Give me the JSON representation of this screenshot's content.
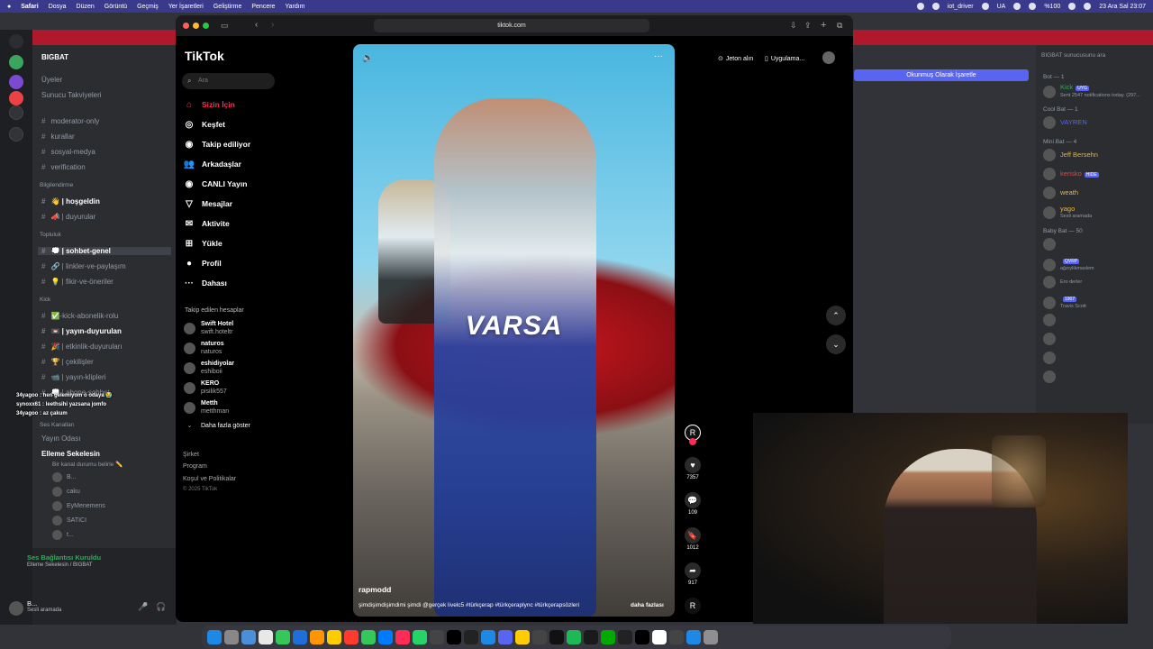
{
  "menubar": {
    "items": [
      "Safari",
      "Dosya",
      "Düzen",
      "Görüntü",
      "Geçmiş",
      "Yer İşaretleri",
      "Geliştirme",
      "Pencere",
      "Yardım"
    ],
    "status": [
      "iot_driver",
      "UA",
      "%100",
      "23 Ara Sal 23:07"
    ]
  },
  "discord": {
    "server_name": "BIGBAT",
    "top_channels": [
      "Üyeler",
      "Sunucu Takviyeleri"
    ],
    "channels": [
      {
        "name": "moderator-only"
      },
      {
        "name": "kurallar"
      },
      {
        "name": "sosyal-medya"
      },
      {
        "name": "verification"
      },
      {
        "cat": "Bilgilendirme"
      },
      {
        "name": "👋 | hoşgeldin",
        "bold": true
      },
      {
        "name": "📣 | duyurular"
      },
      {
        "cat": "Topluluk"
      },
      {
        "name": "💭 | sohbet-genel",
        "active": true
      },
      {
        "name": "🔗 | linkler-ve-paylaşım"
      },
      {
        "name": "💡 | fikir-ve-öneriler"
      },
      {
        "cat": "Kick"
      },
      {
        "name": "✅-kick-abonelik-rolu"
      },
      {
        "name": "📼 | yayın-duyurulan",
        "bold": true
      },
      {
        "name": "🎉 | etkinlik-duyuruları"
      },
      {
        "name": "🏆 | çekilişler"
      },
      {
        "name": "📹 | yayın-klipleri"
      },
      {
        "name": "💭 | abone-sohbet"
      }
    ],
    "voice_category": "Ses Kanalları",
    "voice_channels": [
      "Yayın Odası",
      "Elleme Sekelesin"
    ],
    "voice_status": "Bir kanal durumu belirle ✏️",
    "voice_users": [
      "B...",
      "caku",
      "EyMenemens",
      "SATICI",
      "t..."
    ],
    "overlay_chat": [
      "34yagoo : hen gelemiyom o odaya 😭",
      "synoxx61 : leethsihi yazsana jomfo",
      "34yagoo : az çakum"
    ],
    "connection": {
      "title": "Ses Bağlantısı Kuruldu",
      "sub": "Elleme Sekelesin / BIGBAT"
    },
    "user": {
      "name": "B...",
      "status": "Sesli aramada"
    },
    "unread_button": "Okunmuş Olarak İşaretle",
    "search_placeholder": "BIGBAT sunucusunu ara",
    "member_groups": [
      {
        "title": "Bot — 1",
        "members": [
          {
            "name": "Kick",
            "badge": "UYG",
            "sub": "Sent 2547 notifications today. (297...",
            "color": "#3ba55d"
          }
        ]
      },
      {
        "title": "Cool Bat — 1",
        "members": [
          {
            "name": "VAYREN",
            "color": "#5865f2"
          }
        ]
      },
      {
        "title": "Mini Bat — 4",
        "members": [
          {
            "name": "Jeff Bersehn",
            "color": "#f0b232"
          },
          {
            "name": "kerisko",
            "badge": "HIDE",
            "color": "#ed4245"
          },
          {
            "name": "weath",
            "color": "#f0b232"
          },
          {
            "name": "yago",
            "sub": "Sesli aramada",
            "color": "#f0b232"
          }
        ]
      },
      {
        "title": "Baby Bat — 50",
        "members": [
          {
            "name": "",
            "color": "#eb459e"
          },
          {
            "name": "",
            "badge": "QVRP",
            "sub": "ağzıylikmaslem",
            "color": "#eb459e"
          },
          {
            "name": "",
            "sub": "Ero derler",
            "color": "#eb459e"
          },
          {
            "name": "",
            "badge": "1907",
            "sub": "Travis Scott",
            "color": "#eb459e"
          },
          {
            "name": "",
            "color": "#eb459e"
          },
          {
            "name": "",
            "color": "#eb459e"
          },
          {
            "name": "",
            "color": "#eb459e"
          },
          {
            "name": "",
            "color": "#eb459e"
          }
        ]
      }
    ]
  },
  "safari": {
    "url": "tiktok.com"
  },
  "tiktok": {
    "logo": "TikTok",
    "search_placeholder": "Ara",
    "nav": [
      {
        "label": "Sizin İçin",
        "icon": "⌂",
        "active": true
      },
      {
        "label": "Keşfet",
        "icon": "◎"
      },
      {
        "label": "Takip ediliyor",
        "icon": "◉"
      },
      {
        "label": "Arkadaşlar",
        "icon": "👥"
      },
      {
        "label": "CANLI Yayın",
        "icon": "◉"
      },
      {
        "label": "Mesajlar",
        "icon": "▽"
      },
      {
        "label": "Aktivite",
        "icon": "✉"
      },
      {
        "label": "Yükle",
        "icon": "⊞"
      },
      {
        "label": "Profil",
        "icon": "●"
      },
      {
        "label": "Dahası",
        "icon": "···"
      }
    ],
    "following_title": "Takip edilen hesaplar",
    "following": [
      {
        "name": "Swift Hotel",
        "handle": "swift.hoteltr"
      },
      {
        "name": "naturos",
        "handle": "naturos"
      },
      {
        "name": "eshidiyolar",
        "handle": "eshiboii"
      },
      {
        "name": "KERO",
        "handle": "pisilik557"
      },
      {
        "name": "Metth",
        "handle": "metthman"
      }
    ],
    "show_more": "Daha fazla göster",
    "footer": [
      "Şirket",
      "Program",
      "Koşul ve Politikalar",
      "© 2025 TikTok"
    ],
    "top_buttons": [
      "Jeton alın",
      "Uygulama..."
    ],
    "video": {
      "overlay_text": "VARSA",
      "author": "rapmodd",
      "description": "şimdişimdişimdimi şimdi @gerçek livelc5 #türkçerap #türkçeraplync #türkçerapsözleri",
      "more": "daha fazlası"
    },
    "actions": [
      {
        "icon": "♥",
        "count": "7357"
      },
      {
        "icon": "💬",
        "count": "109"
      },
      {
        "icon": "🔖",
        "count": "1012"
      },
      {
        "icon": "➦",
        "count": "917"
      }
    ]
  }
}
